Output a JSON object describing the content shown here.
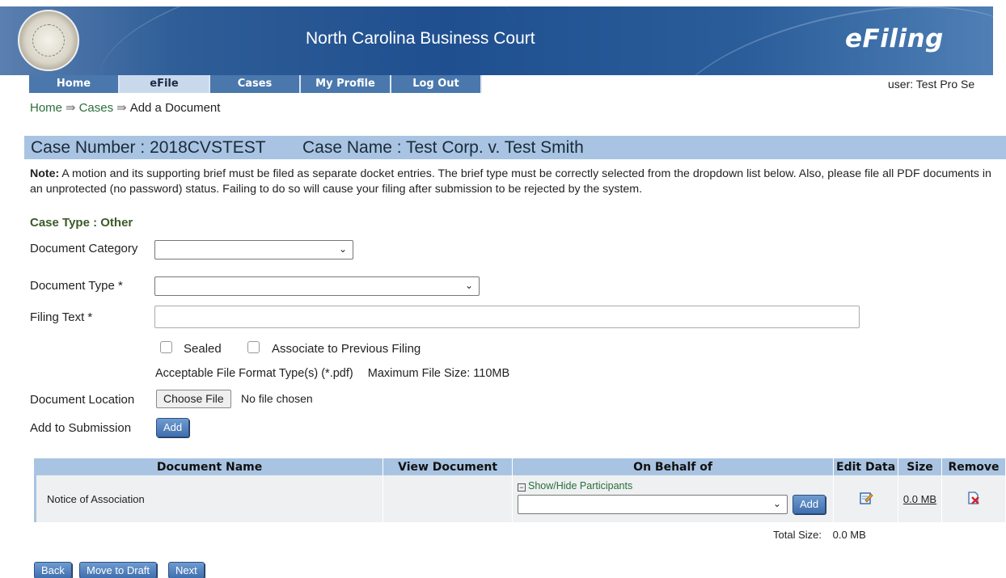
{
  "header": {
    "title": "North Carolina Business Court",
    "brand": "eFiling",
    "seal_icon": "state-seal-icon"
  },
  "nav": {
    "tabs": [
      {
        "label": "Home",
        "active": false
      },
      {
        "label": "eFile",
        "active": true
      },
      {
        "label": "Cases",
        "active": false
      },
      {
        "label": "My Profile",
        "active": false
      },
      {
        "label": "Log Out",
        "active": false
      }
    ],
    "user": "user: Test Pro Se"
  },
  "breadcrumb": {
    "items": [
      "Home",
      "Cases",
      "Add a Document"
    ],
    "separator": "⇛"
  },
  "case": {
    "number": "Case Number : 2018CVSTEST",
    "name": "Case Name : Test Corp. v. Test Smith"
  },
  "note": {
    "label": "Note:",
    "text": " A motion and its supporting brief must be filed as separate docket entries. The brief type must be correctly selected from the dropdown list below. Also, please file all PDF documents in an unprotected (no password) status. Failing to do so will cause your filing after submission to be rejected by the system."
  },
  "form": {
    "case_type": "Case Type : Other",
    "document_category_label": "Document Category",
    "document_category_value": "",
    "document_type_label": "Document Type *",
    "document_type_value": "",
    "filing_text_label": "Filing Text *",
    "filing_text_value": "",
    "sealed_label": "Sealed",
    "associate_label": "Associate to Previous Filing",
    "format_info": "Acceptable File Format Type(s) (*.pdf)",
    "max_size_info": "Maximum File Size: 110MB",
    "document_location_label": "Document Location",
    "choose_file_label": "Choose File",
    "no_file_text": "No file chosen",
    "add_to_submission_label": "Add to Submission",
    "add_button": "Add"
  },
  "table": {
    "headers": [
      "Document Name",
      "View Document",
      "On Behalf of",
      "Edit Data",
      "Size",
      "Remove"
    ],
    "rows": [
      {
        "document_name": "Notice of Association",
        "show_hide": "Show/Hide Participants",
        "behalf_value": "",
        "add_label": "Add",
        "edit_icon": "edit-note-icon",
        "size": "0.0 MB",
        "remove_icon": "remove-document-icon"
      }
    ],
    "total_label": "Total Size:",
    "total_value": "0.0 MB"
  },
  "footer_buttons": {
    "back": "Back",
    "draft": "Move to Draft",
    "next": "Next"
  },
  "colors": {
    "banner": "#1f4f8f",
    "nav_tab": "#4a78ad",
    "nav_active": "#c9d9ec",
    "case_bar": "#a9c4e2",
    "link_green": "#2a6e3a"
  }
}
